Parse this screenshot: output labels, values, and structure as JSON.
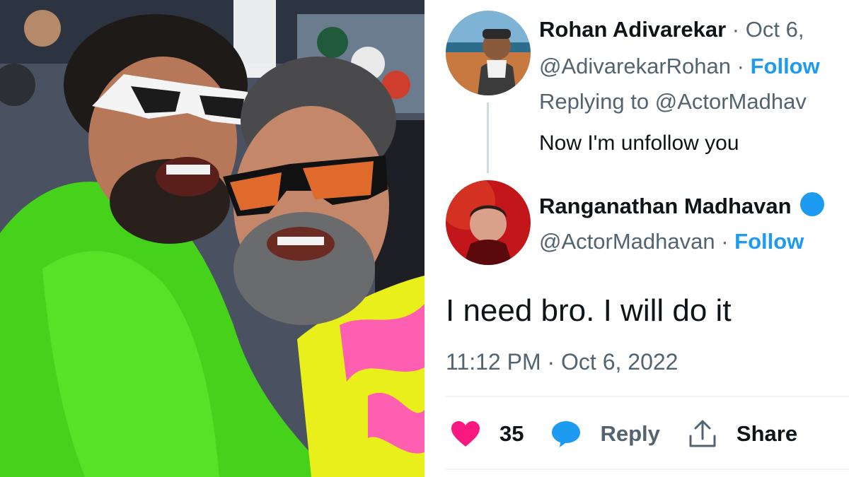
{
  "reply_tweet": {
    "author_name": "Rohan Adivarekar",
    "date": "Oct 6,",
    "handle": "@AdivarekarRohan",
    "follow_label": "Follow",
    "replying_to_prefix": "Replying to",
    "replying_to_handle": "@ActorMadhav",
    "text": "Now I'm unfollow you"
  },
  "main_tweet": {
    "author_name": "Ranganathan Madhavan",
    "handle": "@ActorMadhavan",
    "follow_label": "Follow",
    "text": "I need bro. I will do it",
    "timestamp": "11:12 PM · Oct 6, 2022",
    "likes_count": "35",
    "reply_label": "Reply",
    "share_label": "Share"
  },
  "separator": "·",
  "colors": {
    "link_blue": "#1d9bf0",
    "secondary_text": "#536471",
    "like_pink": "#f91880",
    "reply_blue": "#1d9bf0"
  },
  "icons": {
    "like": "heart-icon",
    "reply": "speech-bubble-icon",
    "share": "share-upload-icon",
    "verified": "verified-badge-icon"
  }
}
